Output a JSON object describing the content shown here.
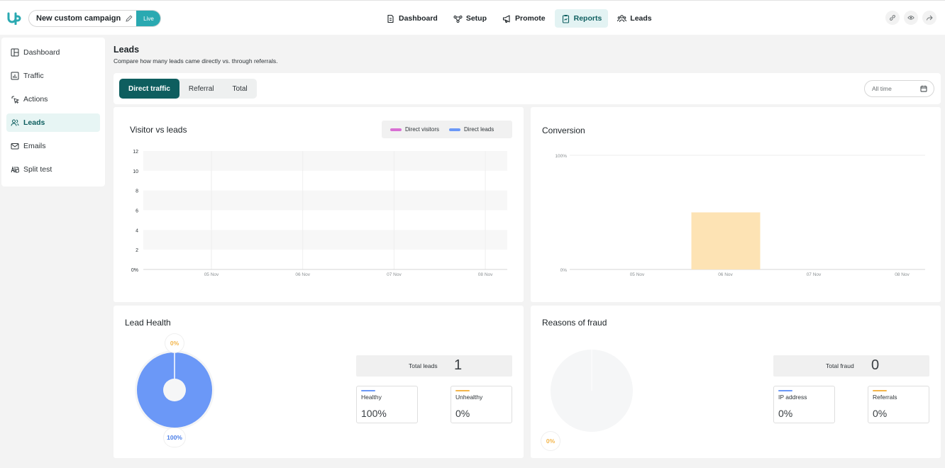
{
  "topbar": {
    "campaign_name": "New custom campaign",
    "status": "Live",
    "nav": [
      {
        "label": "Dashboard"
      },
      {
        "label": "Setup"
      },
      {
        "label": "Promote"
      },
      {
        "label": "Reports"
      },
      {
        "label": "Leads"
      }
    ],
    "active_nav": "Reports"
  },
  "sidebar": {
    "items": [
      {
        "label": "Dashboard"
      },
      {
        "label": "Traffic"
      },
      {
        "label": "Actions"
      },
      {
        "label": "Leads"
      },
      {
        "label": "Emails"
      },
      {
        "label": "Split test"
      }
    ],
    "active": "Leads"
  },
  "page": {
    "title": "Leads",
    "subtitle": "Compare how many leads came directly vs. through referrals."
  },
  "filters": {
    "tabs": [
      "Direct traffic",
      "Referral",
      "Total"
    ],
    "active_tab": "Direct traffic",
    "date_range": "All time"
  },
  "visitor_chart": {
    "title": "Visitor vs leads",
    "legend": [
      "Direct visitors",
      "Direct leads"
    ]
  },
  "conversion_chart": {
    "title": "Conversion"
  },
  "lead_health": {
    "title": "Lead Health",
    "unhealthy_pct_label": "0%",
    "healthy_pct_label": "100%",
    "total_label": "Total leads",
    "total_value": "1",
    "healthy_label": "Healthy",
    "healthy_value": "100%",
    "unhealthy_label": "Unhealthy",
    "unhealthy_value": "0%"
  },
  "fraud": {
    "title": "Reasons of fraud",
    "pct_label": "0%",
    "total_label": "Total fraud",
    "total_value": "0",
    "ip_label": "IP address",
    "ip_value": "0%",
    "referrals_label": "Referrals",
    "referrals_value": "0%"
  },
  "colors": {
    "brand": "#0e5e5f",
    "accent": "#2aa9b1",
    "direct_visitors": "#d86fd3",
    "direct_leads": "#6b98f7",
    "conversion_bar": "#fde3b4",
    "unhealthy": "#f3b54a"
  },
  "chart_data": [
    {
      "type": "bar",
      "title": "Visitor vs leads",
      "categories": [
        "05 Nov",
        "06 Nov",
        "07 Nov",
        "08 Nov"
      ],
      "yticks": [
        "0%",
        "2",
        "4",
        "6",
        "8",
        "10",
        "12"
      ],
      "ylim": [
        0,
        12
      ],
      "series": [
        {
          "name": "Direct visitors",
          "values": [
            0,
            0,
            0,
            0
          ]
        },
        {
          "name": "Direct leads",
          "values": [
            0,
            0,
            0,
            0
          ]
        }
      ],
      "legend": "top-right"
    },
    {
      "type": "bar",
      "title": "Conversion",
      "categories": [
        "05 Nov",
        "06 Nov",
        "07 Nov",
        "08 Nov"
      ],
      "yticks": [
        "0%",
        "100%"
      ],
      "ylim": [
        0,
        100
      ],
      "values": [
        0,
        50,
        0,
        0
      ]
    },
    {
      "type": "pie",
      "title": "Lead Health",
      "labels": [
        "Healthy",
        "Unhealthy"
      ],
      "values": [
        100,
        0
      ]
    }
  ]
}
